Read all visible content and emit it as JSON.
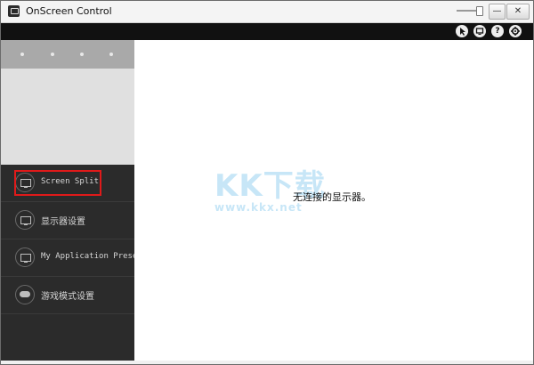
{
  "window": {
    "title": "OnScreen Control"
  },
  "titlebar": {
    "min_glyph": "—",
    "close_glyph": "✕"
  },
  "toolbar": {
    "icons": [
      "cursor-icon",
      "display-icon",
      "help-icon",
      "gear-icon"
    ],
    "help_glyph": "?"
  },
  "sidebar": {
    "items": [
      {
        "label": "Screen Split",
        "icon": "monitor-icon",
        "selected": true
      },
      {
        "label": "显示器设置",
        "icon": "monitor-icon",
        "selected": false
      },
      {
        "label": "My Application Preset",
        "icon": "monitor-icon",
        "selected": false
      },
      {
        "label": "游戏模式设置",
        "icon": "gamepad-icon",
        "selected": false
      }
    ]
  },
  "main": {
    "message": "无连接的显示器。",
    "watermark": {
      "main": "KK下载",
      "url": "www.kkx.net"
    }
  },
  "colors": {
    "highlight": "#e01a1a",
    "sidebar_bg": "#2b2b2b",
    "toolbar_bg": "#111111",
    "watermark": "#9bd3f1"
  }
}
